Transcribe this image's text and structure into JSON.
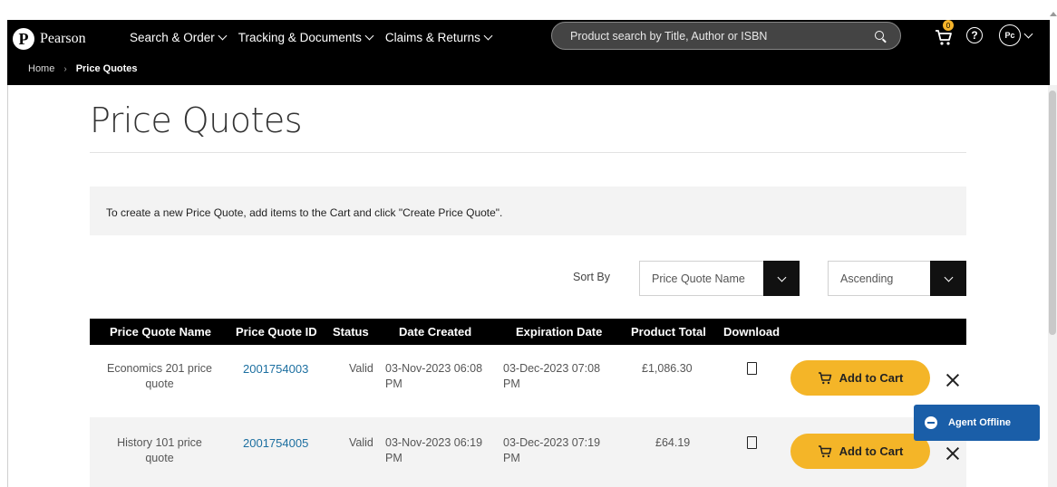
{
  "header": {
    "logo_text": "Pearson",
    "nav": [
      {
        "label": "Search & Order"
      },
      {
        "label": "Tracking & Documents"
      },
      {
        "label": "Claims & Returns"
      }
    ],
    "search_placeholder": "Product search by Title, Author or ISBN",
    "cart_badge": "0",
    "help_glyph": "?",
    "avatar_initials": "Pc"
  },
  "breadcrumb": {
    "home": "Home",
    "separator": "›",
    "current": "Price Quotes"
  },
  "page": {
    "title": "Price Quotes",
    "info_text": "To create a new Price Quote, add items to the Cart and click \"Create Price Quote\"."
  },
  "sort": {
    "label": "Sort By",
    "field_value": "Price Quote Name",
    "order_value": "Ascending"
  },
  "table": {
    "columns": [
      "Price Quote Name",
      "Price Quote ID",
      "Status",
      "Date Created",
      "Expiration Date",
      "Product Total",
      "Download"
    ],
    "rows": [
      {
        "name_line1": "Economics 201 price",
        "name_line2": "quote",
        "id": "2001754003",
        "status": "Valid",
        "created_line1": "03-Nov-2023 06:08",
        "created_line2": "PM",
        "expires_line1": "03-Dec-2023 07:08",
        "expires_line2": "PM",
        "total": "£1,086.30",
        "add_label": "Add to Cart"
      },
      {
        "name_line1": "History 101 price",
        "name_line2": "quote",
        "id": "2001754005",
        "status": "Valid",
        "created_line1": "03-Nov-2023 06:19",
        "created_line2": "PM",
        "expires_line1": "03-Dec-2023 07:19",
        "expires_line2": "PM",
        "total": "£64.19",
        "add_label": "Add to Cart"
      }
    ]
  },
  "chat": {
    "label": "Agent Offline"
  },
  "colors": {
    "header_bg": "#000000",
    "accent_button": "#f4b528",
    "link": "#1c6fa0",
    "chat_bg": "#1a5ea8"
  }
}
